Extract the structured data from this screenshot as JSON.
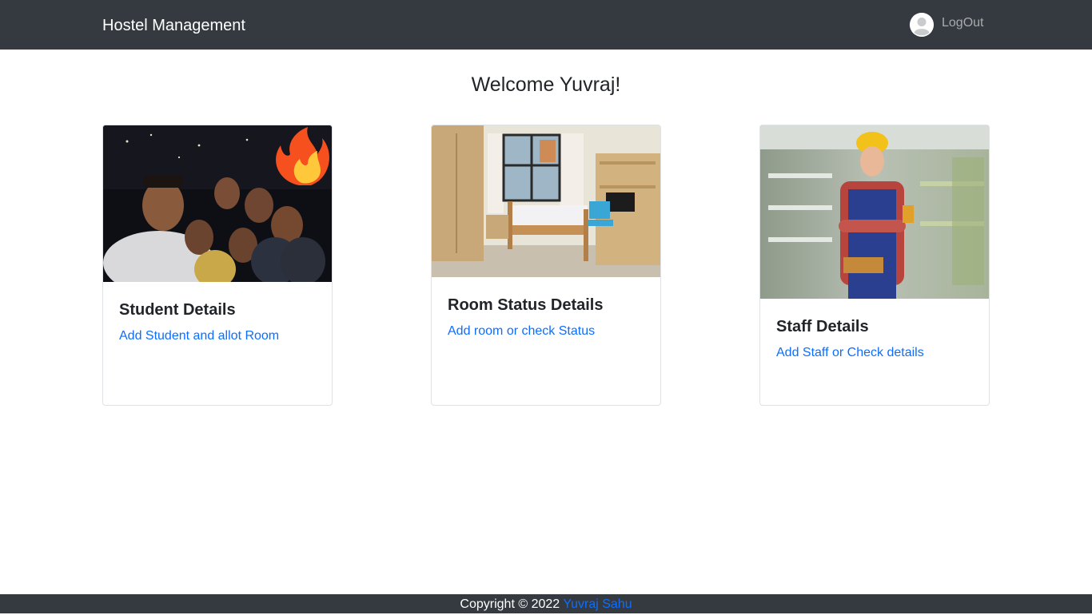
{
  "navbar": {
    "brand": "Hostel Management",
    "logout_label": "LogOut",
    "avatar_icon": "user-avatar-icon"
  },
  "welcome": "Welcome Yuvraj!",
  "cards": [
    {
      "title": "Student Details",
      "link": "Add Student and allot Room",
      "image": "group-selfie-photo"
    },
    {
      "title": "Room Status Details",
      "link": "Add room or check Status",
      "image": "hostel-room-photo"
    },
    {
      "title": "Staff Details",
      "link": "Add Staff or Check details",
      "image": "worker-photo"
    }
  ],
  "footer": {
    "copyright": "Copyright © 2022",
    "author": "Yuvraj Sahu"
  },
  "colors": {
    "navbar_bg": "#343a40",
    "link": "#0d6efd",
    "muted": "#a8abad"
  }
}
